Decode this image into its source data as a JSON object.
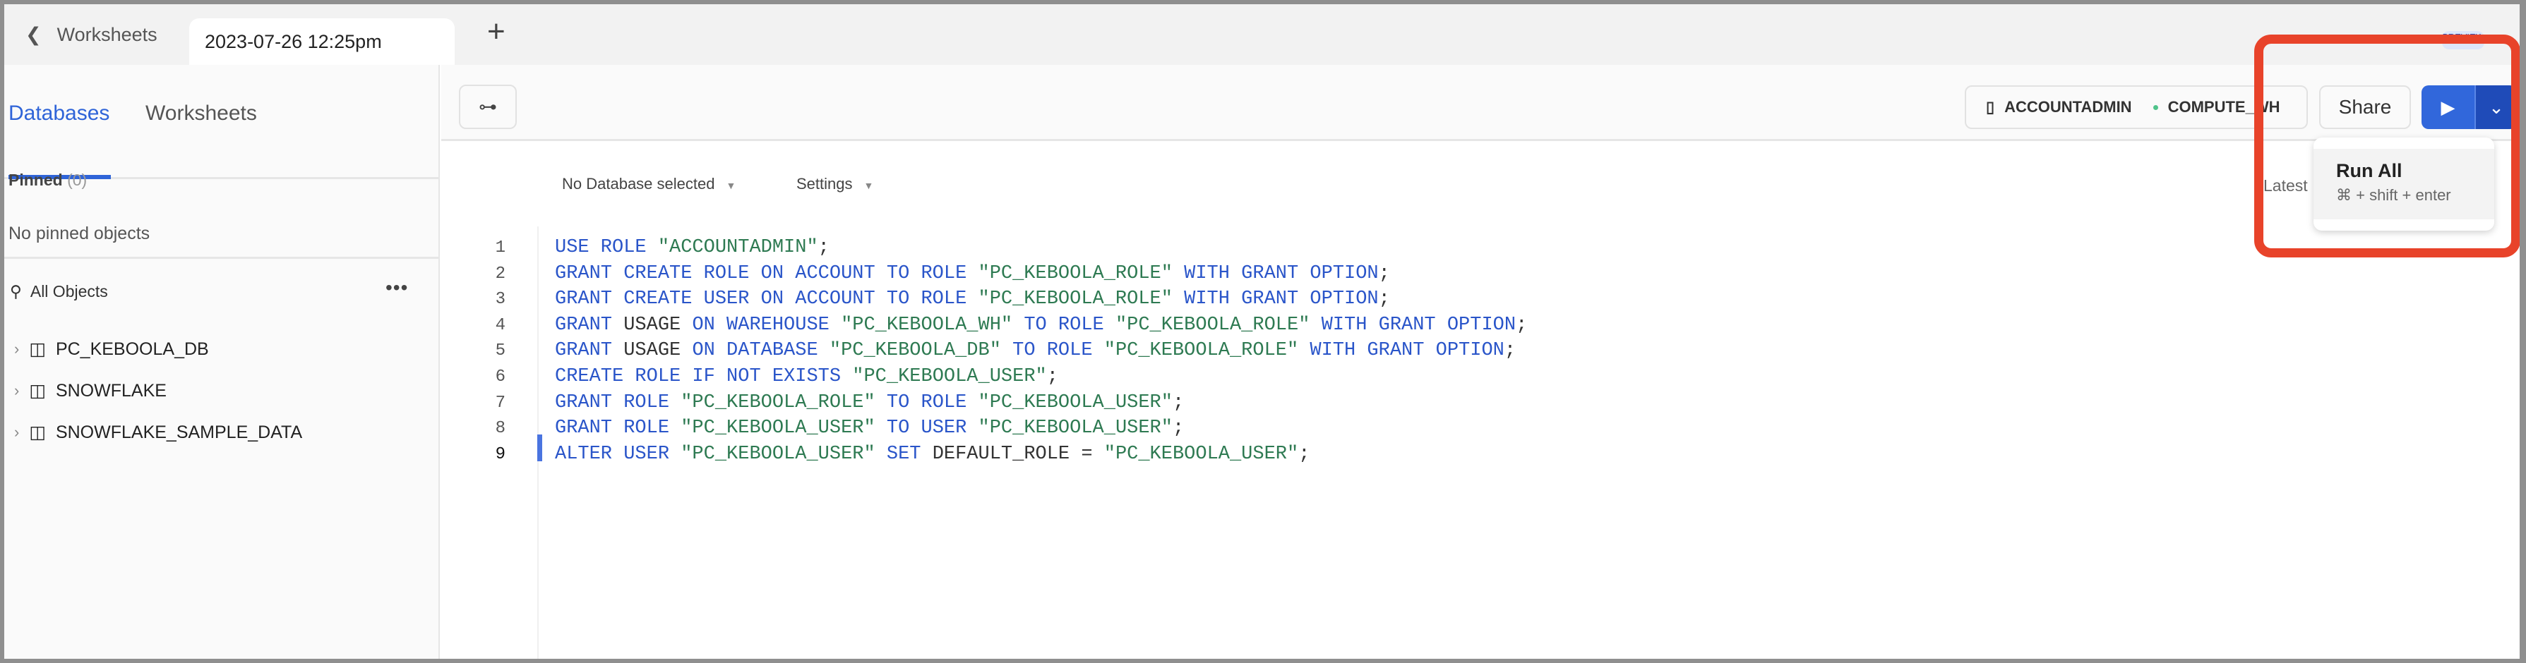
{
  "topbar": {
    "back_label": "Worksheets",
    "active_tab": "2023-07-26 12:25pm",
    "new_tab": "+",
    "preview_badge": "PREVIEW"
  },
  "sidebar": {
    "tabs": [
      {
        "label": "Databases",
        "active": true
      },
      {
        "label": "Worksheets",
        "active": false
      }
    ],
    "pinned_label": "Pinned",
    "pinned_count": "(0)",
    "no_pinned": "No pinned objects",
    "all_objects": "All Objects",
    "more": "•••",
    "databases": [
      {
        "label": "PC_KEBOOLA_DB"
      },
      {
        "label": "SNOWFLAKE"
      },
      {
        "label": "SNOWFLAKE_SAMPLE_DATA"
      }
    ]
  },
  "toolbar": {
    "role": "ACCOUNTADMIN",
    "warehouse": "COMPUTE_WH",
    "share": "Share",
    "run_icon": "play-icon",
    "run_menu_icon": "chevron-down-icon"
  },
  "editor": {
    "database_select": "No Database selected",
    "settings": "Settings",
    "latest": "Latest",
    "current_line": 9,
    "lines": [
      [
        [
          "kw",
          "USE ROLE "
        ],
        [
          "str",
          "\"ACCOUNTADMIN\""
        ],
        [
          "txt",
          ";"
        ]
      ],
      [
        [
          "kw",
          "GRANT CREATE ROLE ON ACCOUNT TO ROLE "
        ],
        [
          "str",
          "\"PC_KEBOOLA_ROLE\""
        ],
        [
          "kw",
          " WITH GRANT OPTION"
        ],
        [
          "txt",
          ";"
        ]
      ],
      [
        [
          "kw",
          "GRANT CREATE USER ON ACCOUNT TO ROLE "
        ],
        [
          "str",
          "\"PC_KEBOOLA_ROLE\""
        ],
        [
          "kw",
          " WITH GRANT OPTION"
        ],
        [
          "txt",
          ";"
        ]
      ],
      [
        [
          "kw",
          "GRANT "
        ],
        [
          "txt",
          "USAGE "
        ],
        [
          "kw",
          "ON WAREHOUSE "
        ],
        [
          "str",
          "\"PC_KEBOOLA_WH\""
        ],
        [
          "kw",
          " TO ROLE "
        ],
        [
          "str",
          "\"PC_KEBOOLA_ROLE\""
        ],
        [
          "kw",
          " WITH GRANT OPTION"
        ],
        [
          "txt",
          ";"
        ]
      ],
      [
        [
          "kw",
          "GRANT "
        ],
        [
          "txt",
          "USAGE "
        ],
        [
          "kw",
          "ON DATABASE "
        ],
        [
          "str",
          "\"PC_KEBOOLA_DB\""
        ],
        [
          "kw",
          " TO ROLE "
        ],
        [
          "str",
          "\"PC_KEBOOLA_ROLE\""
        ],
        [
          "kw",
          " WITH GRANT OPTION"
        ],
        [
          "txt",
          ";"
        ]
      ],
      [
        [
          "kw",
          "CREATE ROLE IF NOT EXISTS "
        ],
        [
          "str",
          "\"PC_KEBOOLA_USER\""
        ],
        [
          "txt",
          ";"
        ]
      ],
      [
        [
          "kw",
          "GRANT ROLE "
        ],
        [
          "str",
          "\"PC_KEBOOLA_ROLE\""
        ],
        [
          "kw",
          " TO ROLE "
        ],
        [
          "str",
          "\"PC_KEBOOLA_USER\""
        ],
        [
          "txt",
          ";"
        ]
      ],
      [
        [
          "kw",
          "GRANT ROLE "
        ],
        [
          "str",
          "\"PC_KEBOOLA_USER\""
        ],
        [
          "kw",
          " TO USER "
        ],
        [
          "str",
          "\"PC_KEBOOLA_USER\""
        ],
        [
          "txt",
          ";"
        ]
      ],
      [
        [
          "kw",
          "ALTER USER "
        ],
        [
          "str",
          "\"PC_KEBOOLA_USER\""
        ],
        [
          "kw",
          " SET "
        ],
        [
          "txt",
          "DEFAULT_ROLE = "
        ],
        [
          "str",
          "\"PC_KEBOOLA_USER\""
        ],
        [
          "txt",
          ";"
        ]
      ]
    ]
  },
  "run_dropdown": {
    "item": "Run All",
    "shortcut": "⌘ + shift + enter"
  },
  "colors": {
    "accent": "#2f64d8",
    "keyword": "#2a55c9",
    "string": "#2e7a52",
    "highlight_box": "#e8432a"
  }
}
